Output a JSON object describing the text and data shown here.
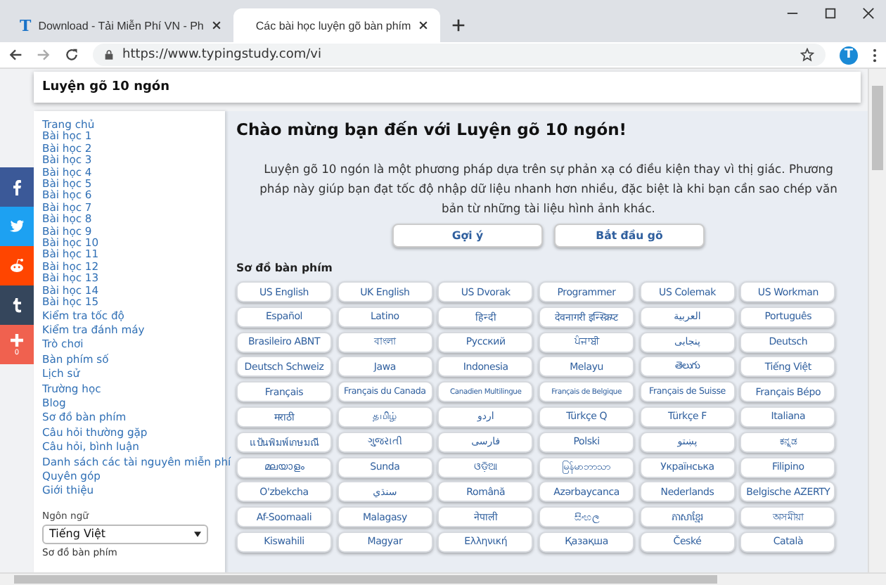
{
  "browser": {
    "tabs": [
      {
        "favicon": "T",
        "title": "Download - Tải Miễn Phí VN - Ph",
        "selected": false
      },
      {
        "title": "Các bài học luyện gõ bàn phím",
        "selected": true
      }
    ],
    "url": "https://www.typingstudy.com/vi",
    "profile": {
      "initial": "T"
    }
  },
  "page_header": {
    "title": "Luyện gõ 10 ngón"
  },
  "share_bar": {
    "items": [
      {
        "kind": "facebook"
      },
      {
        "kind": "twitter"
      },
      {
        "kind": "reddit"
      },
      {
        "kind": "tumblr"
      },
      {
        "kind": "more",
        "count": "0"
      }
    ]
  },
  "sidebar": {
    "items": [
      "Trang chủ",
      "Bài học 1",
      "Bài học 2",
      "Bài học 3",
      "Bài học 4",
      "Bài học 5",
      "Bài học 6",
      "Bài học 7",
      "Bài học 8",
      "Bài học 9",
      "Bài học 10",
      "Bài học 11",
      "Bài học 12",
      "Bài học 13",
      "Bài học 14",
      "Bài học 15",
      "Kiểm tra tốc độ",
      "Kiểm tra đánh máy",
      "Trò chơi",
      "Bàn phím số",
      "Lịch sử",
      "Trường học",
      "Blog",
      "Sơ đồ bàn phím",
      "Câu hỏi thường gặp",
      "Câu hỏi, bình luận",
      "Danh sách các tài nguyên miễn phí",
      "Quyên góp",
      "Giới thiệu"
    ],
    "language": {
      "label": "Ngôn ngữ",
      "value": "Tiếng Việt"
    },
    "footer_label": "Sơ đồ bàn phím"
  },
  "main": {
    "title": "Chào mừng bạn đến với Luyện gõ 10 ngón!",
    "intro": "Luyện gõ 10 ngón là một phương pháp dựa trên sự phản xạ có điều kiện thay vì thị giác. Phương pháp này giúp bạn đạt tốc độ nhập dữ liệu nhanh hơn nhiều, đặc biệt là khi bạn cần sao chép văn bản từ những tài liệu hình ảnh khác.",
    "buttons": [
      "Gợi ý",
      "Bắt đầu gõ"
    ],
    "layouts_title": "Sơ đồ bàn phím",
    "layouts": [
      "US English",
      "UK English",
      "US Dvorak",
      "Programmer",
      "US Colemak",
      "US Workman",
      "Español",
      "Latino",
      "हिन्दी",
      "देवनागरी इन्स्क्रिप्ट",
      "العربية",
      "Português",
      "Brasileiro ABNT",
      "বাংলা",
      "Русский",
      "ਪੰਜਾਬੀ",
      "پنجابی",
      "Deutsch",
      "Deutsch Schweiz",
      "Jawa",
      "Indonesia",
      "Melayu",
      "తెలుగు",
      "Tiếng Việt",
      "Français",
      "Français du Canada",
      "Canadien Multilingue",
      "Français de Belgique",
      "Français de Suisse",
      "Français Bépo",
      "मराठी",
      "தமிழ்",
      "اردو",
      "Türkçe Q",
      "Türkçe F",
      "Italiana",
      "แป้นพิมพ์เกษมณี",
      "ગુજરાતી",
      "فارسی",
      "Polski",
      "پښتو",
      "ಕನ್ನಡ",
      "മലയാളം",
      "Sunda",
      "ଓଡ଼ିଆ",
      "မြန်မာဘာသာ",
      "Українська",
      "Filipino",
      "O'zbekcha",
      "سنڌي",
      "Română",
      "Azərbaycanca",
      "Nederlands",
      "Belgische AZERTY",
      "Af-Soomaali",
      "Malagasy",
      "नेपाली",
      "සිංහල",
      "ភាសាខ្មែរ",
      "অসমীয়া",
      "Kiswahili",
      "Magyar",
      "Ελληνική",
      "Қазақша",
      "České",
      "Català"
    ]
  }
}
